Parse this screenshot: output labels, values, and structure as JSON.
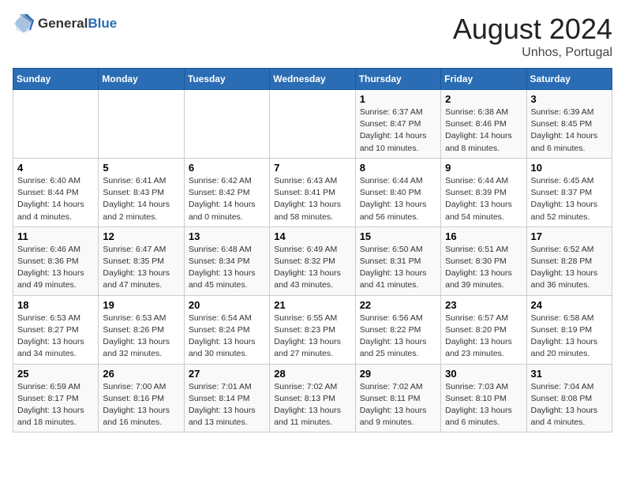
{
  "header": {
    "logo_general": "General",
    "logo_blue": "Blue",
    "month_year": "August 2024",
    "location": "Unhos, Portugal"
  },
  "days_of_week": [
    "Sunday",
    "Monday",
    "Tuesday",
    "Wednesday",
    "Thursday",
    "Friday",
    "Saturday"
  ],
  "weeks": [
    [
      {
        "day": "",
        "content": ""
      },
      {
        "day": "",
        "content": ""
      },
      {
        "day": "",
        "content": ""
      },
      {
        "day": "",
        "content": ""
      },
      {
        "day": "1",
        "content": "Sunrise: 6:37 AM\nSunset: 8:47 PM\nDaylight: 14 hours and 10 minutes."
      },
      {
        "day": "2",
        "content": "Sunrise: 6:38 AM\nSunset: 8:46 PM\nDaylight: 14 hours and 8 minutes."
      },
      {
        "day": "3",
        "content": "Sunrise: 6:39 AM\nSunset: 8:45 PM\nDaylight: 14 hours and 6 minutes."
      }
    ],
    [
      {
        "day": "4",
        "content": "Sunrise: 6:40 AM\nSunset: 8:44 PM\nDaylight: 14 hours and 4 minutes."
      },
      {
        "day": "5",
        "content": "Sunrise: 6:41 AM\nSunset: 8:43 PM\nDaylight: 14 hours and 2 minutes."
      },
      {
        "day": "6",
        "content": "Sunrise: 6:42 AM\nSunset: 8:42 PM\nDaylight: 14 hours and 0 minutes."
      },
      {
        "day": "7",
        "content": "Sunrise: 6:43 AM\nSunset: 8:41 PM\nDaylight: 13 hours and 58 minutes."
      },
      {
        "day": "8",
        "content": "Sunrise: 6:44 AM\nSunset: 8:40 PM\nDaylight: 13 hours and 56 minutes."
      },
      {
        "day": "9",
        "content": "Sunrise: 6:44 AM\nSunset: 8:39 PM\nDaylight: 13 hours and 54 minutes."
      },
      {
        "day": "10",
        "content": "Sunrise: 6:45 AM\nSunset: 8:37 PM\nDaylight: 13 hours and 52 minutes."
      }
    ],
    [
      {
        "day": "11",
        "content": "Sunrise: 6:46 AM\nSunset: 8:36 PM\nDaylight: 13 hours and 49 minutes."
      },
      {
        "day": "12",
        "content": "Sunrise: 6:47 AM\nSunset: 8:35 PM\nDaylight: 13 hours and 47 minutes."
      },
      {
        "day": "13",
        "content": "Sunrise: 6:48 AM\nSunset: 8:34 PM\nDaylight: 13 hours and 45 minutes."
      },
      {
        "day": "14",
        "content": "Sunrise: 6:49 AM\nSunset: 8:32 PM\nDaylight: 13 hours and 43 minutes."
      },
      {
        "day": "15",
        "content": "Sunrise: 6:50 AM\nSunset: 8:31 PM\nDaylight: 13 hours and 41 minutes."
      },
      {
        "day": "16",
        "content": "Sunrise: 6:51 AM\nSunset: 8:30 PM\nDaylight: 13 hours and 39 minutes."
      },
      {
        "day": "17",
        "content": "Sunrise: 6:52 AM\nSunset: 8:28 PM\nDaylight: 13 hours and 36 minutes."
      }
    ],
    [
      {
        "day": "18",
        "content": "Sunrise: 6:53 AM\nSunset: 8:27 PM\nDaylight: 13 hours and 34 minutes."
      },
      {
        "day": "19",
        "content": "Sunrise: 6:53 AM\nSunset: 8:26 PM\nDaylight: 13 hours and 32 minutes."
      },
      {
        "day": "20",
        "content": "Sunrise: 6:54 AM\nSunset: 8:24 PM\nDaylight: 13 hours and 30 minutes."
      },
      {
        "day": "21",
        "content": "Sunrise: 6:55 AM\nSunset: 8:23 PM\nDaylight: 13 hours and 27 minutes."
      },
      {
        "day": "22",
        "content": "Sunrise: 6:56 AM\nSunset: 8:22 PM\nDaylight: 13 hours and 25 minutes."
      },
      {
        "day": "23",
        "content": "Sunrise: 6:57 AM\nSunset: 8:20 PM\nDaylight: 13 hours and 23 minutes."
      },
      {
        "day": "24",
        "content": "Sunrise: 6:58 AM\nSunset: 8:19 PM\nDaylight: 13 hours and 20 minutes."
      }
    ],
    [
      {
        "day": "25",
        "content": "Sunrise: 6:59 AM\nSunset: 8:17 PM\nDaylight: 13 hours and 18 minutes."
      },
      {
        "day": "26",
        "content": "Sunrise: 7:00 AM\nSunset: 8:16 PM\nDaylight: 13 hours and 16 minutes."
      },
      {
        "day": "27",
        "content": "Sunrise: 7:01 AM\nSunset: 8:14 PM\nDaylight: 13 hours and 13 minutes."
      },
      {
        "day": "28",
        "content": "Sunrise: 7:02 AM\nSunset: 8:13 PM\nDaylight: 13 hours and 11 minutes."
      },
      {
        "day": "29",
        "content": "Sunrise: 7:02 AM\nSunset: 8:11 PM\nDaylight: 13 hours and 9 minutes."
      },
      {
        "day": "30",
        "content": "Sunrise: 7:03 AM\nSunset: 8:10 PM\nDaylight: 13 hours and 6 minutes."
      },
      {
        "day": "31",
        "content": "Sunrise: 7:04 AM\nSunset: 8:08 PM\nDaylight: 13 hours and 4 minutes."
      }
    ]
  ]
}
